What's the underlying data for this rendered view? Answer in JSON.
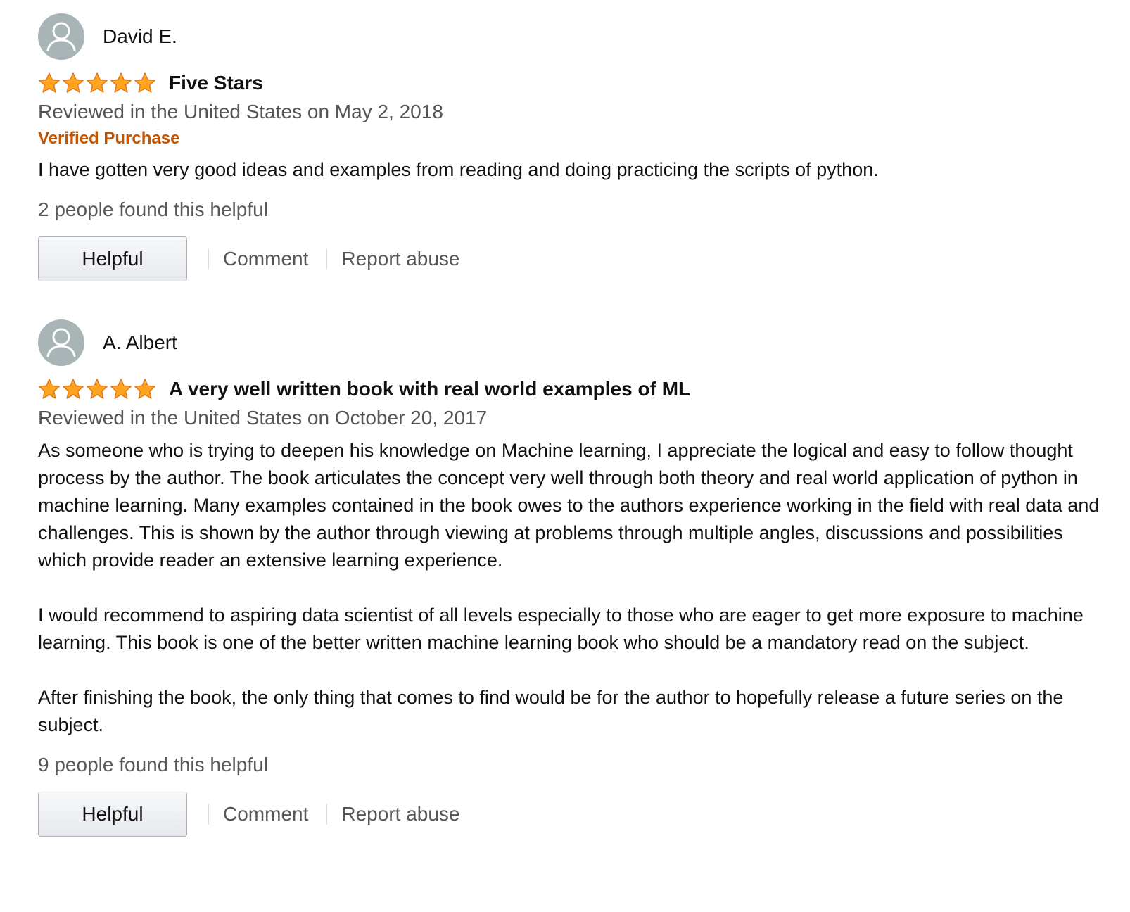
{
  "colors": {
    "star_fill": "#ffa41c",
    "star_stroke": "#de7921",
    "verified": "#c45500",
    "muted_text": "#555555",
    "avatar_bg": "#a9b4b6"
  },
  "reviews": [
    {
      "reviewer": "David E.",
      "avatar_icon": "user-silhouette-icon",
      "rating": 5,
      "rating_max": 5,
      "title": "Five Stars",
      "date": "Reviewed in the United States on May 2, 2018",
      "verified": "Verified Purchase",
      "body": [
        "I have gotten very good ideas and examples from reading and doing practicing the scripts of python."
      ],
      "helpful_count": "2 people found this helpful",
      "helpful_button": "Helpful",
      "comment_link": "Comment",
      "report_link": "Report abuse"
    },
    {
      "reviewer": "A. Albert",
      "avatar_icon": "user-silhouette-icon",
      "rating": 5,
      "rating_max": 5,
      "title": "A very well written book with real world examples of ML",
      "date": "Reviewed in the United States on October 20, 2017",
      "body": [
        "As someone who is trying to deepen his knowledge on Machine learning, I appreciate the logical and easy to follow thought process by the author. The book articulates the concept very well through both theory and real world application of python in machine learning. Many examples contained in the book owes to the authors experience working in the field with real data and challenges. This is shown by the author through viewing at problems through multiple angles, discussions and possibilities which provide reader an extensive learning experience.",
        "I would recommend to aspiring data scientist of all levels especially to those who are eager to get more exposure to machine learning. This book is one of the better written machine learning book who should be a mandatory read on the subject.",
        "After finishing the book, the only thing that comes to find would be for the author to hopefully release a future series on the subject."
      ],
      "helpful_count": "9 people found this helpful",
      "helpful_button": "Helpful",
      "comment_link": "Comment",
      "report_link": "Report abuse"
    }
  ]
}
